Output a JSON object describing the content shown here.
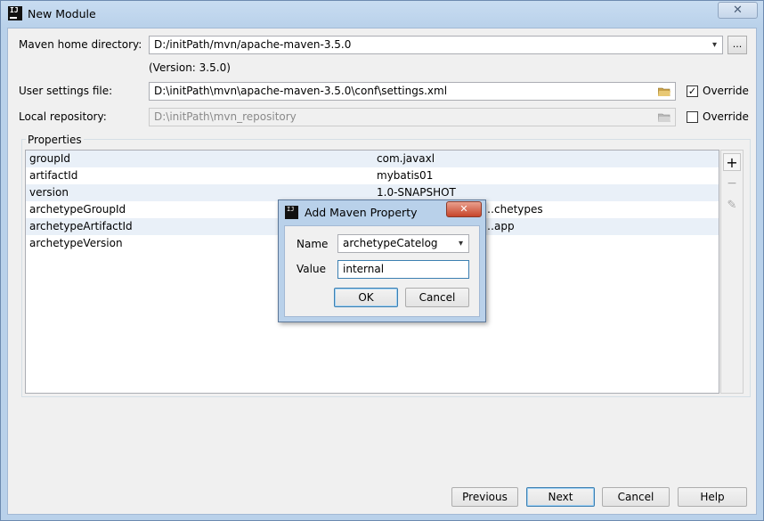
{
  "window": {
    "title": "New Module",
    "close_glyph": "✕"
  },
  "maven": {
    "home_label": "Maven home directory:",
    "home_value": "D:/initPath/mvn/apache-maven-3.5.0",
    "version_text": "(Version: 3.5.0)",
    "browse_label": "...",
    "settings_label": "User settings file:",
    "settings_value": "D:\\initPath\\mvn\\apache-maven-3.5.0\\conf\\settings.xml",
    "settings_override_checked": true,
    "repo_label": "Local repository:",
    "repo_value": "D:\\initPath\\mvn_repository",
    "repo_override_checked": false,
    "override_label": "Override"
  },
  "properties": {
    "group_label": "Properties",
    "rows": [
      {
        "key": "groupId",
        "value": "com.javaxl"
      },
      {
        "key": "artifactId",
        "value": "mybatis01"
      },
      {
        "key": "version",
        "value": "1.0-SNAPSHOT"
      },
      {
        "key": "archetypeGroupId",
        "value": "…chetypes"
      },
      {
        "key": "archetypeArtifactId",
        "value": "…app"
      },
      {
        "key": "archetypeVersion",
        "value": ""
      }
    ],
    "tools": {
      "add": "+",
      "remove": "−",
      "edit": "✎"
    }
  },
  "footer": {
    "previous": "Previous",
    "next": "Next",
    "cancel": "Cancel",
    "help": "Help"
  },
  "dialog": {
    "title": "Add Maven Property",
    "name_label": "Name",
    "name_value": "archetypeCatelog",
    "value_label": "Value",
    "value_value": "internal",
    "ok": "OK",
    "cancel": "Cancel",
    "close_glyph": "✕"
  }
}
